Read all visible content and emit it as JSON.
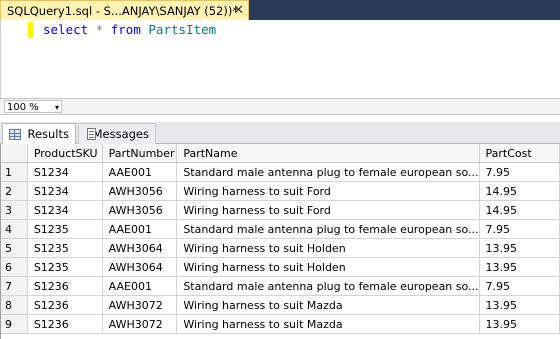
{
  "document_tab": {
    "title": "SQLQuery1.sql - S...ANJAY\\SANJAY (52))*",
    "close": "✕"
  },
  "editor": {
    "kw_select": "select",
    "op_star": "*",
    "kw_from": "from",
    "table": "PartsItem"
  },
  "zoom": {
    "value": "100 %",
    "arrow": "▾"
  },
  "results_tabs": {
    "results_label": "Results",
    "messages_label": "Messages"
  },
  "grid": {
    "columns": [
      "ProductSKU",
      "PartNumber",
      "PartName",
      "PartCost"
    ],
    "rows": [
      [
        "1",
        "S1234",
        "AAE001",
        "Standard male antenna plug to female european so...",
        "7.95"
      ],
      [
        "2",
        "S1234",
        "AWH3056",
        "Wiring harness to suit Ford",
        "14.95"
      ],
      [
        "3",
        "S1234",
        "AWH3056",
        "Wiring harness to suit Ford",
        "14.95"
      ],
      [
        "4",
        "S1235",
        "AAE001",
        "Standard male antenna plug to female european so...",
        "7.95"
      ],
      [
        "5",
        "S1235",
        "AWH3064",
        "Wiring harness to suit Holden",
        "13.95"
      ],
      [
        "6",
        "S1235",
        "AWH3064",
        "Wiring harness to suit Holden",
        "13.95"
      ],
      [
        "7",
        "S1236",
        "AAE001",
        "Standard male antenna plug to female european so...",
        "7.95"
      ],
      [
        "8",
        "S1236",
        "AWH3072",
        "Wiring harness to suit Mazda",
        "13.95"
      ],
      [
        "9",
        "S1236",
        "AWH3072",
        "Wiring harness to suit Mazda",
        "13.95"
      ]
    ]
  }
}
